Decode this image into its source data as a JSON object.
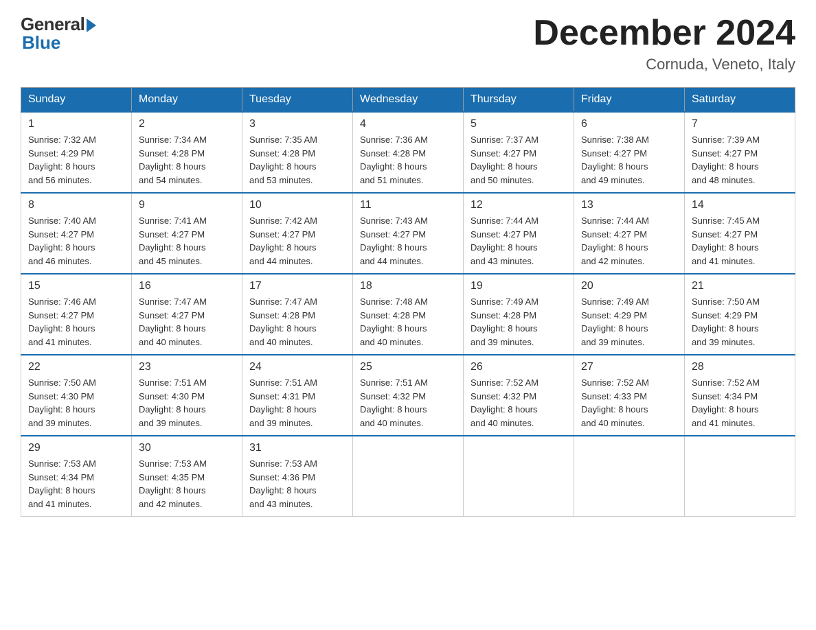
{
  "logo": {
    "general": "General",
    "blue": "Blue"
  },
  "title": "December 2024",
  "location": "Cornuda, Veneto, Italy",
  "days_of_week": [
    "Sunday",
    "Monday",
    "Tuesday",
    "Wednesday",
    "Thursday",
    "Friday",
    "Saturday"
  ],
  "weeks": [
    [
      {
        "day": "1",
        "sunrise": "7:32 AM",
        "sunset": "4:29 PM",
        "daylight": "8 hours and 56 minutes."
      },
      {
        "day": "2",
        "sunrise": "7:34 AM",
        "sunset": "4:28 PM",
        "daylight": "8 hours and 54 minutes."
      },
      {
        "day": "3",
        "sunrise": "7:35 AM",
        "sunset": "4:28 PM",
        "daylight": "8 hours and 53 minutes."
      },
      {
        "day": "4",
        "sunrise": "7:36 AM",
        "sunset": "4:28 PM",
        "daylight": "8 hours and 51 minutes."
      },
      {
        "day": "5",
        "sunrise": "7:37 AM",
        "sunset": "4:27 PM",
        "daylight": "8 hours and 50 minutes."
      },
      {
        "day": "6",
        "sunrise": "7:38 AM",
        "sunset": "4:27 PM",
        "daylight": "8 hours and 49 minutes."
      },
      {
        "day": "7",
        "sunrise": "7:39 AM",
        "sunset": "4:27 PM",
        "daylight": "8 hours and 48 minutes."
      }
    ],
    [
      {
        "day": "8",
        "sunrise": "7:40 AM",
        "sunset": "4:27 PM",
        "daylight": "8 hours and 46 minutes."
      },
      {
        "day": "9",
        "sunrise": "7:41 AM",
        "sunset": "4:27 PM",
        "daylight": "8 hours and 45 minutes."
      },
      {
        "day": "10",
        "sunrise": "7:42 AM",
        "sunset": "4:27 PM",
        "daylight": "8 hours and 44 minutes."
      },
      {
        "day": "11",
        "sunrise": "7:43 AM",
        "sunset": "4:27 PM",
        "daylight": "8 hours and 44 minutes."
      },
      {
        "day": "12",
        "sunrise": "7:44 AM",
        "sunset": "4:27 PM",
        "daylight": "8 hours and 43 minutes."
      },
      {
        "day": "13",
        "sunrise": "7:44 AM",
        "sunset": "4:27 PM",
        "daylight": "8 hours and 42 minutes."
      },
      {
        "day": "14",
        "sunrise": "7:45 AM",
        "sunset": "4:27 PM",
        "daylight": "8 hours and 41 minutes."
      }
    ],
    [
      {
        "day": "15",
        "sunrise": "7:46 AM",
        "sunset": "4:27 PM",
        "daylight": "8 hours and 41 minutes."
      },
      {
        "day": "16",
        "sunrise": "7:47 AM",
        "sunset": "4:27 PM",
        "daylight": "8 hours and 40 minutes."
      },
      {
        "day": "17",
        "sunrise": "7:47 AM",
        "sunset": "4:28 PM",
        "daylight": "8 hours and 40 minutes."
      },
      {
        "day": "18",
        "sunrise": "7:48 AM",
        "sunset": "4:28 PM",
        "daylight": "8 hours and 40 minutes."
      },
      {
        "day": "19",
        "sunrise": "7:49 AM",
        "sunset": "4:28 PM",
        "daylight": "8 hours and 39 minutes."
      },
      {
        "day": "20",
        "sunrise": "7:49 AM",
        "sunset": "4:29 PM",
        "daylight": "8 hours and 39 minutes."
      },
      {
        "day": "21",
        "sunrise": "7:50 AM",
        "sunset": "4:29 PM",
        "daylight": "8 hours and 39 minutes."
      }
    ],
    [
      {
        "day": "22",
        "sunrise": "7:50 AM",
        "sunset": "4:30 PM",
        "daylight": "8 hours and 39 minutes."
      },
      {
        "day": "23",
        "sunrise": "7:51 AM",
        "sunset": "4:30 PM",
        "daylight": "8 hours and 39 minutes."
      },
      {
        "day": "24",
        "sunrise": "7:51 AM",
        "sunset": "4:31 PM",
        "daylight": "8 hours and 39 minutes."
      },
      {
        "day": "25",
        "sunrise": "7:51 AM",
        "sunset": "4:32 PM",
        "daylight": "8 hours and 40 minutes."
      },
      {
        "day": "26",
        "sunrise": "7:52 AM",
        "sunset": "4:32 PM",
        "daylight": "8 hours and 40 minutes."
      },
      {
        "day": "27",
        "sunrise": "7:52 AM",
        "sunset": "4:33 PM",
        "daylight": "8 hours and 40 minutes."
      },
      {
        "day": "28",
        "sunrise": "7:52 AM",
        "sunset": "4:34 PM",
        "daylight": "8 hours and 41 minutes."
      }
    ],
    [
      {
        "day": "29",
        "sunrise": "7:53 AM",
        "sunset": "4:34 PM",
        "daylight": "8 hours and 41 minutes."
      },
      {
        "day": "30",
        "sunrise": "7:53 AM",
        "sunset": "4:35 PM",
        "daylight": "8 hours and 42 minutes."
      },
      {
        "day": "31",
        "sunrise": "7:53 AM",
        "sunset": "4:36 PM",
        "daylight": "8 hours and 43 minutes."
      },
      null,
      null,
      null,
      null
    ]
  ],
  "labels": {
    "sunrise": "Sunrise:",
    "sunset": "Sunset:",
    "daylight": "Daylight:"
  }
}
